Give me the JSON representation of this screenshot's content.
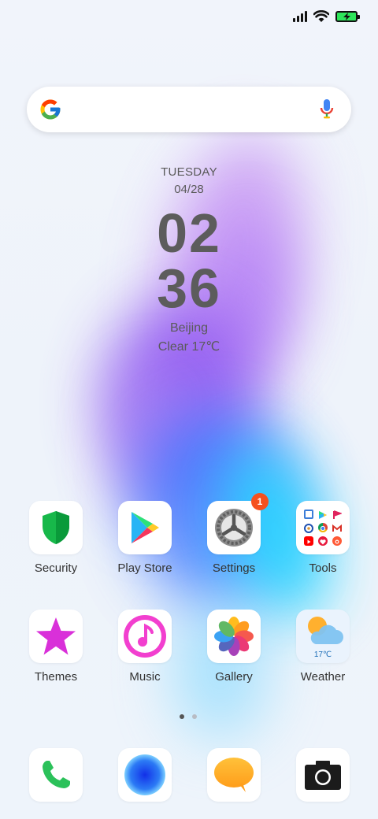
{
  "status": {
    "signal": "cellular-signal-icon",
    "wifi": "wifi-icon",
    "battery": "battery-charging-icon",
    "battery_color": "#2ee65b"
  },
  "search": {
    "logo": "google-g-icon",
    "mic": "mic-icon"
  },
  "clock": {
    "day": "TUESDAY",
    "date": "04/28",
    "hours": "02",
    "minutes": "36",
    "city": "Beijing",
    "weather": "Clear  17℃"
  },
  "apps": [
    {
      "label": "Security",
      "icon": "shield-icon"
    },
    {
      "label": "Play Store",
      "icon": "play-store-icon"
    },
    {
      "label": "Settings",
      "icon": "gear-icon",
      "badge": "1"
    },
    {
      "label": "Tools",
      "icon": "tools-folder-icon"
    },
    {
      "label": "Themes",
      "icon": "star-icon"
    },
    {
      "label": "Music",
      "icon": "music-note-icon"
    },
    {
      "label": "Gallery",
      "icon": "flower-icon"
    },
    {
      "label": "Weather",
      "icon": "weather-icon",
      "temp": "17℃"
    }
  ],
  "page_indicator": {
    "count": 2,
    "active": 0
  },
  "dock": [
    {
      "icon": "phone-icon"
    },
    {
      "icon": "browser-icon"
    },
    {
      "icon": "message-icon"
    },
    {
      "icon": "camera-icon"
    }
  ]
}
